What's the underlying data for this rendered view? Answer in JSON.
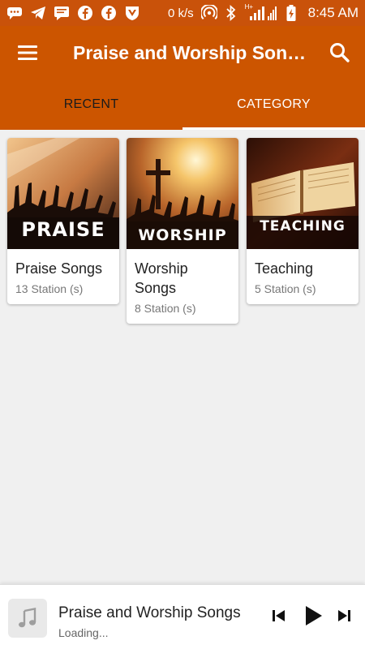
{
  "status_bar": {
    "speed": "0 k/s",
    "network": "H+",
    "time": "8:45 AM",
    "icons": [
      "chat-icon",
      "telegram-icon",
      "message-icon",
      "facebook-icon",
      "facebook-icon",
      "vpn-shield-icon",
      "hotspot-icon",
      "bluetooth-icon",
      "signal-icon",
      "battery-charging-icon"
    ]
  },
  "app_bar": {
    "title": "Praise and Worship Songs",
    "menu_icon": "menu-icon",
    "search_icon": "search-icon"
  },
  "tabs": [
    {
      "label": "RECENT",
      "selected": false
    },
    {
      "label": "CATEGORY",
      "selected": true
    }
  ],
  "categories": [
    {
      "title": "Praise Songs",
      "subtitle": "13 Station (s)",
      "thumb_text": "PRAISE"
    },
    {
      "title": "Worship Songs",
      "subtitle": "8 Station (s)",
      "thumb_text": "WORSHIP"
    },
    {
      "title": "Teaching",
      "subtitle": "5 Station (s)",
      "thumb_text": "TEACHING"
    }
  ],
  "player": {
    "title": "Praise and Worship Songs",
    "status": "Loading...",
    "art_icon": "music-note-icon"
  },
  "colors": {
    "primary": "#cc5500",
    "status_bar": "#c9520a",
    "tab_selected_text": "#ffffff",
    "tab_unselected_text": "#1b1b1b"
  }
}
